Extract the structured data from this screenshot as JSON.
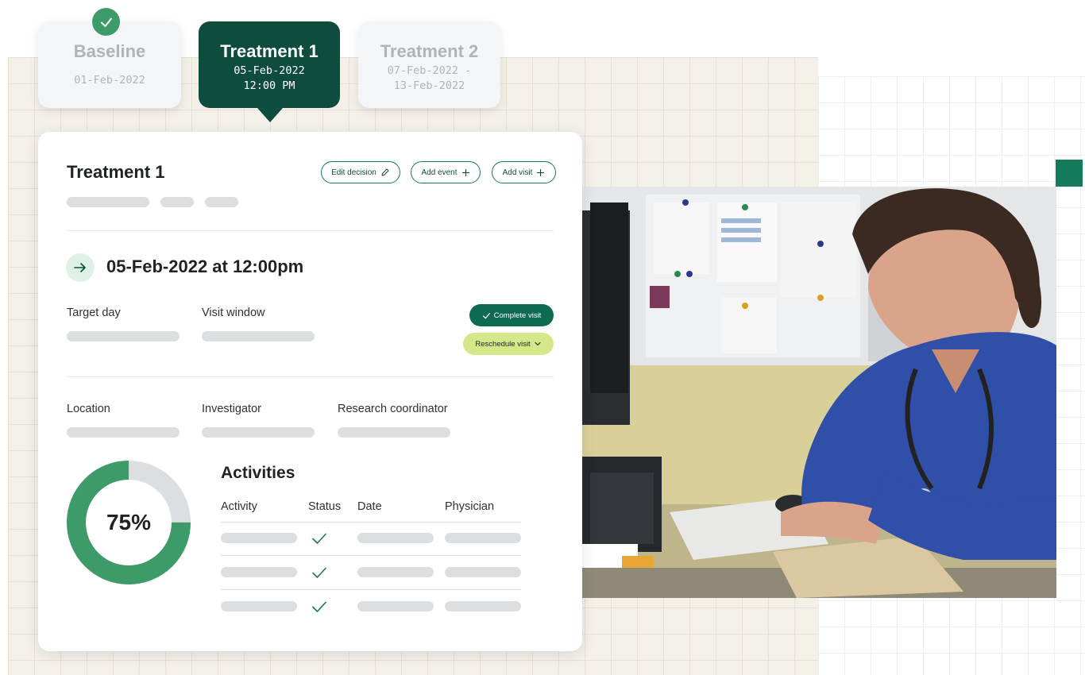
{
  "tabs": [
    {
      "title": "Baseline",
      "sub1": "01-Feb-2022",
      "sub2": "",
      "state": "completed"
    },
    {
      "title": "Treatment 1",
      "sub1": "05-Feb-2022",
      "sub2": "12:00 PM",
      "state": "active"
    },
    {
      "title": "Treatment 2",
      "sub1": "07-Feb-2022 -",
      "sub2": "13-Feb-2022",
      "state": "inactive"
    }
  ],
  "card": {
    "title": "Treatment 1",
    "buttons": {
      "edit_decision": "Edit decision",
      "add_event": "Add event",
      "add_visit": "Add visit"
    },
    "visit_datetime": "05-Feb-2022 at 12:00pm",
    "fields": {
      "target_day": "Target day",
      "visit_window": "Visit window",
      "location": "Location",
      "investigator": "Investigator",
      "research_coordinator": "Research coordinator"
    },
    "actions": {
      "complete_visit": "Complete visit",
      "reschedule_visit": "Reschedule visit"
    },
    "progress": {
      "value": 75,
      "label": "75%"
    },
    "activities": {
      "title": "Activities",
      "columns": [
        "Activity",
        "Status",
        "Date",
        "Physician"
      ],
      "rows": [
        {
          "status": "done"
        },
        {
          "status": "done"
        },
        {
          "status": "done"
        }
      ]
    }
  },
  "colors": {
    "brand_dark": "#0e4d3e",
    "brand": "#137a5c",
    "progress": "#3d9a69",
    "accent_lime": "#d4e88a"
  },
  "icons": {
    "tab_check": "check-icon",
    "edit": "pencil-icon",
    "add": "plus-icon",
    "arrow": "arrow-right-icon",
    "complete": "check-icon",
    "reschedule": "chevron-down-icon",
    "status": "check-icon"
  }
}
